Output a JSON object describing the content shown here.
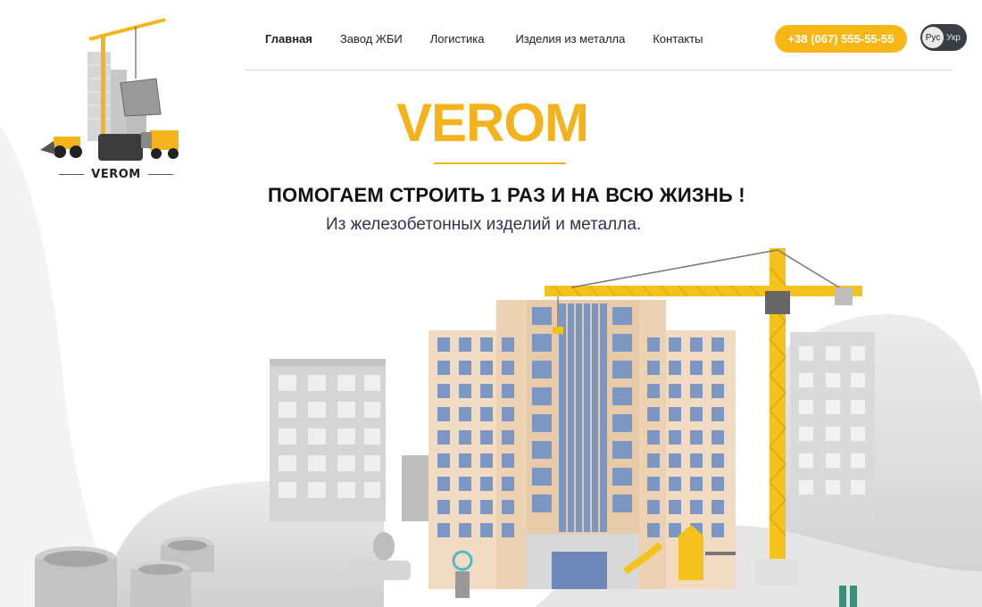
{
  "logo": {
    "text": "VEROM"
  },
  "nav": {
    "items": [
      {
        "label": "Главная",
        "active": true
      },
      {
        "label": "Завод ЖБИ",
        "active": false
      },
      {
        "label": "Логистика",
        "active": false
      },
      {
        "label": "Изделия из металла",
        "active": false
      },
      {
        "label": "Контакты",
        "active": false
      }
    ]
  },
  "header": {
    "phone": "+38 (067) 555-55-55",
    "lang_active": "Рус",
    "lang_other": "Укр"
  },
  "hero": {
    "brand": "VEROM",
    "headline_part1": "ПОМОГАЕМ СТРОИТЬ",
    "headline_part2": " 1 РАЗ И НА ВСЮ ЖИЗНЬ !",
    "subline": "Из железобетонных изделий и металла."
  },
  "colors": {
    "accent": "#f7b717",
    "dark": "#3a3f45",
    "building_blue": "#7d97c4",
    "building_wall": "#f1dcc3"
  },
  "icons": [
    "crane-icon",
    "truck-icon",
    "loader-icon",
    "concrete-ring-icon"
  ]
}
